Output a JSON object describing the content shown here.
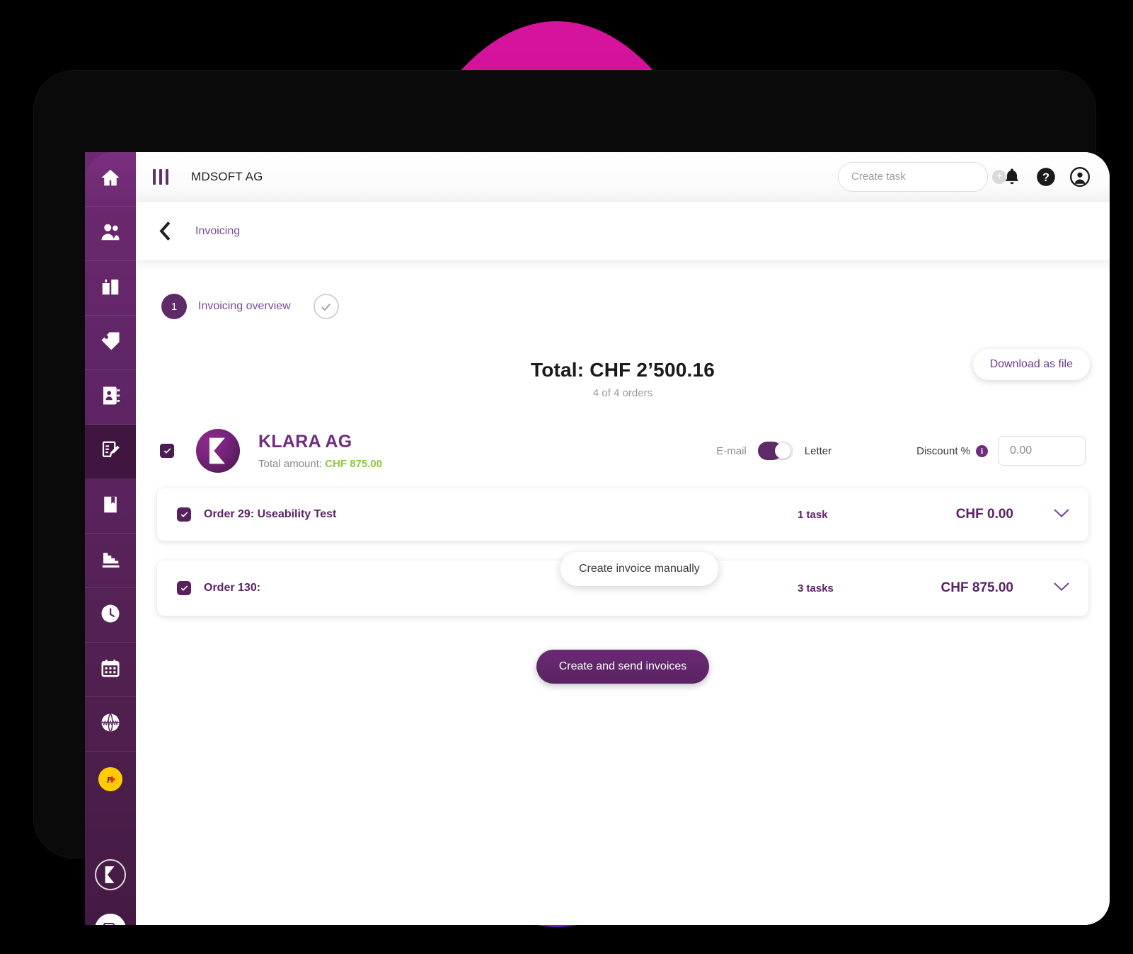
{
  "topbar": {
    "menu_icon": "vertical-bars-menu-icon",
    "org_name": "MDSOFT AG",
    "task_placeholder": "Create task",
    "task_value": "",
    "plus_icon": "plus-icon",
    "bell_icon": "bell-icon",
    "help_icon": "help-icon",
    "account_icon": "account-icon"
  },
  "breadcrumb": {
    "back_icon": "chevron-left-icon",
    "label": "Invoicing"
  },
  "steps": [
    {
      "number": "1",
      "label": "Invoicing overview",
      "check_icon": "check-circle-icon"
    }
  ],
  "summary": {
    "total": "Total: CHF 2’500.16",
    "orders": "4 of 4 orders",
    "download_label": "Download as file"
  },
  "customer": {
    "checked": true,
    "logo": "klara-logo-icon",
    "name": "KLARA AG",
    "total_label": "Total amount:",
    "total_value": "CHF 875.00",
    "delivery": {
      "left_label": "E-mail",
      "right_label": "Letter",
      "selected": "E-mail"
    },
    "discount": {
      "label": "Discount %",
      "info_icon": "info-icon",
      "value": "0.00",
      "placeholder": "0.00"
    }
  },
  "orders": [
    {
      "checked": true,
      "title": "Order 29: Useability Test",
      "tasks": "1 task",
      "amount": "CHF 0.00",
      "chevron_icon": "chevron-down-icon"
    },
    {
      "checked": true,
      "title": "Order 130:",
      "tasks": "3 tasks",
      "amount": "CHF 875.00",
      "chevron_icon": "chevron-down-icon",
      "manual_label": "Create invoice manually"
    }
  ],
  "actions": {
    "send_label": "Create and send invoices"
  },
  "sidebar": {
    "items": [
      {
        "name": "home",
        "icon": "home-icon",
        "active": false
      },
      {
        "name": "contacts",
        "icon": "people-icon",
        "active": false
      },
      {
        "name": "companies",
        "icon": "buildings-icon",
        "active": false
      },
      {
        "name": "products",
        "icon": "tag-icon",
        "active": false
      },
      {
        "name": "address-book",
        "icon": "address-book-icon",
        "active": false
      },
      {
        "name": "invoicing",
        "icon": "clipboard-check-icon",
        "active": true
      },
      {
        "name": "accounting",
        "icon": "book-bookmark-icon",
        "active": false
      },
      {
        "name": "reports",
        "icon": "stairs-chart-icon",
        "active": false
      },
      {
        "name": "time-tracking",
        "icon": "clock-icon",
        "active": false
      },
      {
        "name": "calendar",
        "icon": "calendar-icon",
        "active": false
      },
      {
        "name": "website",
        "icon": "www-globe-icon",
        "active": false
      },
      {
        "name": "postfinance",
        "icon": "postfinance-icon",
        "active": false
      },
      {
        "name": "klara-badge",
        "icon": "klara-logo-icon",
        "active": false
      },
      {
        "name": "support-chat",
        "icon": "chat-bubbles-icon",
        "active": false
      }
    ]
  },
  "colors": {
    "brand_purple": "#5f2a68",
    "accent_violet": "#7b4b93",
    "green": "#8ec63f",
    "magenta": "#d6139b",
    "deep_purple": "#6b1cc0"
  }
}
